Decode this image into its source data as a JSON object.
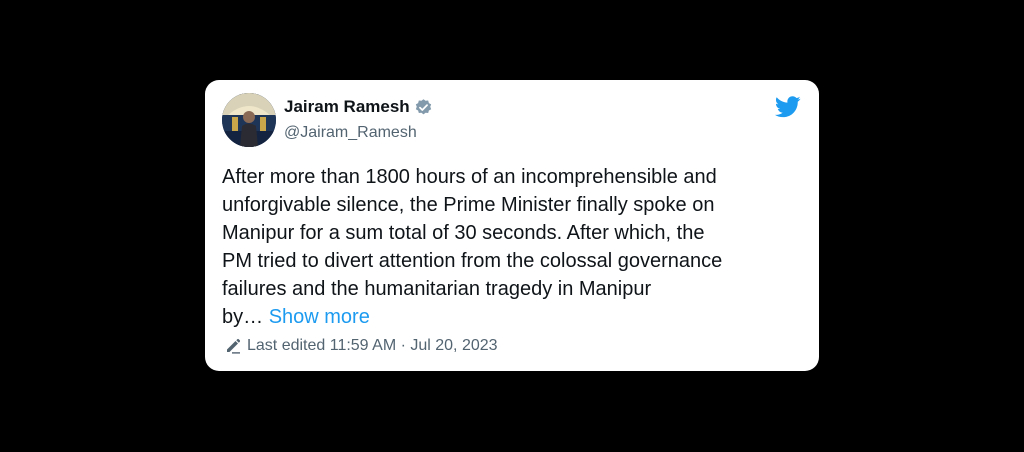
{
  "author": {
    "name": "Jairam Ramesh",
    "handle": "@Jairam_Ramesh",
    "verified": true,
    "avatar_icon": "profile-photo"
  },
  "brand": {
    "icon": "twitter-bird-icon",
    "color": "#1d9bf0"
  },
  "tweet": {
    "text": "After more than 1800 hours of an incomprehensible and\nunforgivable silence, the Prime Minister finally spoke on\nManipur for a sum total of 30 seconds. After which, the\nPM tried to divert attention from the colossal  governance\nfailures and the humanitarian tragedy in Manipur\nby… ",
    "show_more_label": "Show more"
  },
  "edited": {
    "label": "Last edited 11:59 AM · Jul 20, 2023",
    "icon": "pencil-icon"
  },
  "colors": {
    "background": "#000000",
    "card": "#ffffff",
    "text": "#0f1419",
    "secondary_text": "#536471",
    "accent": "#1d9bf0"
  }
}
